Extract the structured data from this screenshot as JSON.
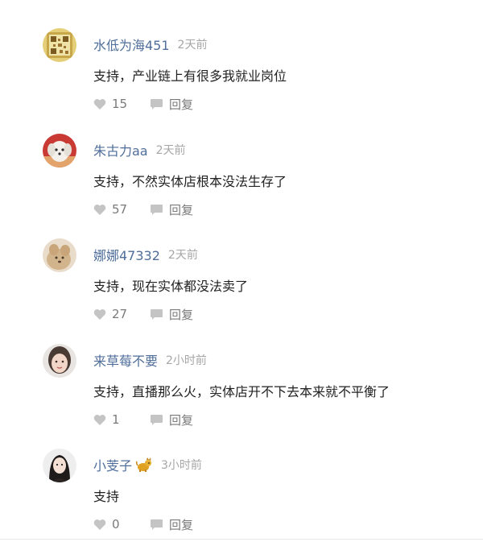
{
  "comments": [
    {
      "username": "水低为海451",
      "time": "2天前",
      "text": "支持，产业链上有很多我就业岗位",
      "likes": "15",
      "reply": "回复",
      "avatar": "qr-pattern-avatar"
    },
    {
      "username": "朱古力aa",
      "time": "2天前",
      "text": "支持，不然实体店根本没法生存了",
      "likes": "57",
      "reply": "回复",
      "avatar": "white-dog-avatar"
    },
    {
      "username": "娜娜47332",
      "time": "2天前",
      "text": "支持，现在实体都没法卖了",
      "likes": "27",
      "reply": "回复",
      "avatar": "beige-pet-avatar"
    },
    {
      "username": "来草莓不要",
      "time": "2小时前",
      "text": "支持，直播那么火，实体店开不下去本来就不平衡了",
      "likes": "1",
      "reply": "回复",
      "avatar": "woman-portrait-avatar"
    },
    {
      "username": "小芰子",
      "time": "3小时前",
      "text": "支持",
      "likes": "0",
      "reply": "回复",
      "avatar": "woman-dark-hair-avatar",
      "badge": "dog-badge-icon"
    }
  ],
  "colors": {
    "username": "#4f6e9a",
    "time": "#a6a6a6",
    "text": "#222222",
    "action": "#7a7a7a",
    "icon": "#c4c4c4"
  }
}
